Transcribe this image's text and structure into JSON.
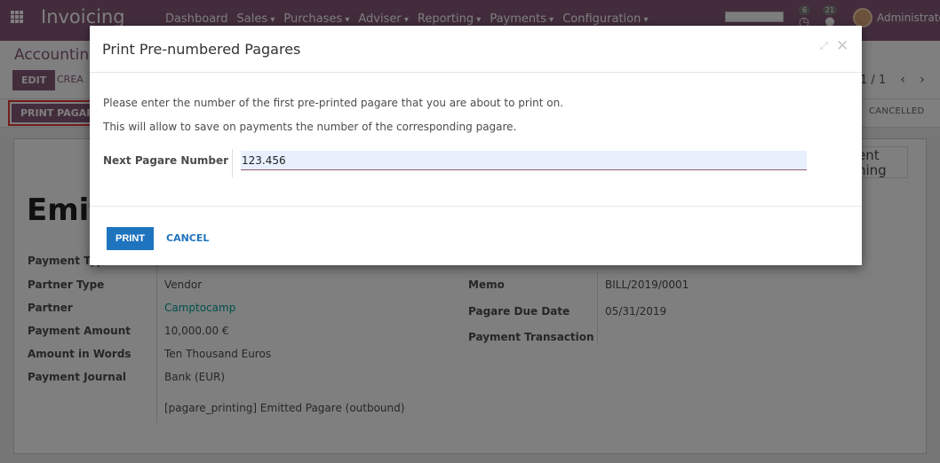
{
  "navbar": {
    "app_name": "Invoicing",
    "menu": [
      "Dashboard",
      "Sales",
      "Purchases",
      "Adviser",
      "Reporting",
      "Payments",
      "Configuration"
    ],
    "progress_fraction": 0.0,
    "activity_count": "6",
    "messages_count": "21",
    "user": "Administrato"
  },
  "control_panel": {
    "breadcrumb": "Accounting",
    "edit_label": "EDIT",
    "create_label": "CREA",
    "pager": "1 / 1"
  },
  "statusbar": {
    "print_pagare_label": "PRINT PAGARE",
    "state": "CANCELLED"
  },
  "sheet": {
    "smart_button_label": "ent\nhing",
    "title": "Emit",
    "left_fields": [
      {
        "label": "Payment Typ",
        "value": ""
      },
      {
        "label": "Partner Type",
        "value": "Vendor"
      },
      {
        "label": "Partner",
        "value": "Camptocamp"
      },
      {
        "label": "Payment Amount",
        "value": "10,000.00 €"
      },
      {
        "label": "Amount in Words",
        "value": "Ten Thousand Euros"
      },
      {
        "label": "Payment Journal",
        "value": "Bank (EUR)"
      }
    ],
    "extra_line": "[pagare_printing] Emitted Pagare (outbound)",
    "right_fields": [
      {
        "label": "Memo",
        "value": "BILL/2019/0001"
      },
      {
        "label": "Pagare Due Date",
        "value": "05/31/2019"
      },
      {
        "label": "Payment Transaction",
        "value": ""
      }
    ]
  },
  "modal": {
    "title": "Print Pre-numbered Pagares",
    "line1": "Please enter the number of the first pre-printed pagare that you are about to print on.",
    "line2": "This will allow to save on payments the number of the corresponding pagare.",
    "field_label": "Next Pagare Number",
    "field_value": "123.456",
    "print_label": "PRINT",
    "cancel_label": "CANCEL"
  }
}
